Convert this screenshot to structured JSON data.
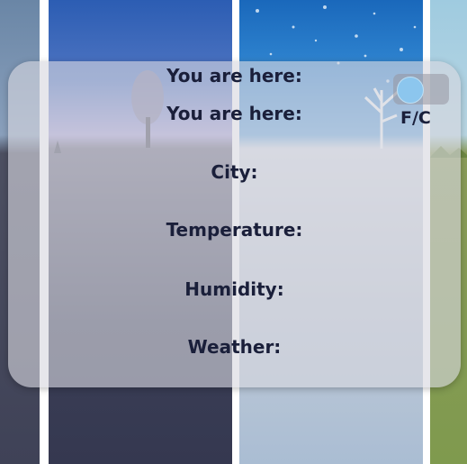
{
  "location": {
    "heading_primary": "You are here:",
    "heading_secondary": "You are here:"
  },
  "fields": {
    "city_label": "City:",
    "temperature_label": "Temperature:",
    "humidity_label": "Humidity:",
    "weather_label": "Weather:"
  },
  "unit_toggle": {
    "label": "F/C"
  },
  "colors": {
    "card_background": "#d7d7de",
    "text": "#1a1f3a",
    "toggle_knob": "#8cc6ee"
  },
  "icons": [
    "tree-icon",
    "bare-tree-icon",
    "snowflake-icon"
  ]
}
